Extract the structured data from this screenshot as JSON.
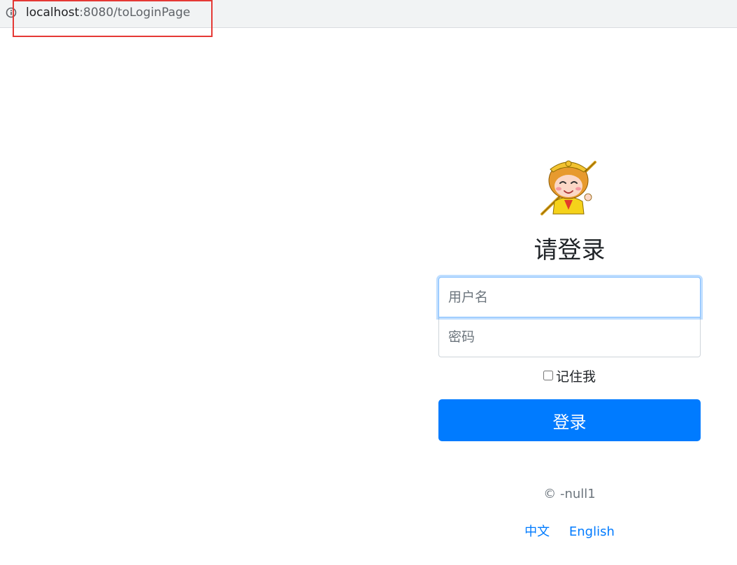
{
  "browser": {
    "url_host": "localhost",
    "url_rest": ":8080/toLoginPage"
  },
  "login": {
    "title": "请登录",
    "username_placeholder": "用户名",
    "password_placeholder": "密码",
    "remember_label": "记住我",
    "remember_checked": false,
    "submit_label": "登录",
    "copyright": "© -null1",
    "languages": [
      "中文",
      "English"
    ]
  },
  "colors": {
    "primary": "#007bff",
    "highlight_box": "#e53935"
  }
}
